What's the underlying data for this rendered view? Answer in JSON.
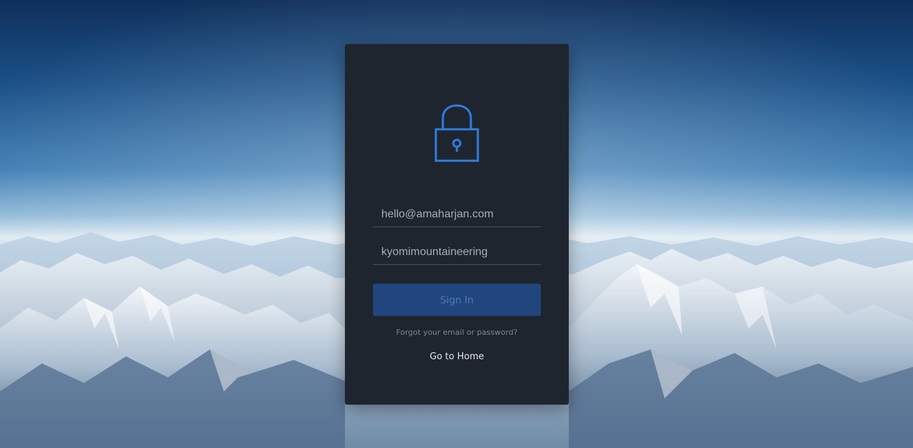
{
  "background": {
    "description_icon": "mountain-landscape-image"
  },
  "login": {
    "icon": "lock-icon",
    "accent_color": "#2f7fe0",
    "email": {
      "value": "hello@amaharjan.com",
      "placeholder": ""
    },
    "password": {
      "value": "kyomimountaineering",
      "placeholder": ""
    },
    "signin_label": "Sign In",
    "forgot_label": "Forgot your email or password?",
    "home_label": "Go to Home"
  }
}
